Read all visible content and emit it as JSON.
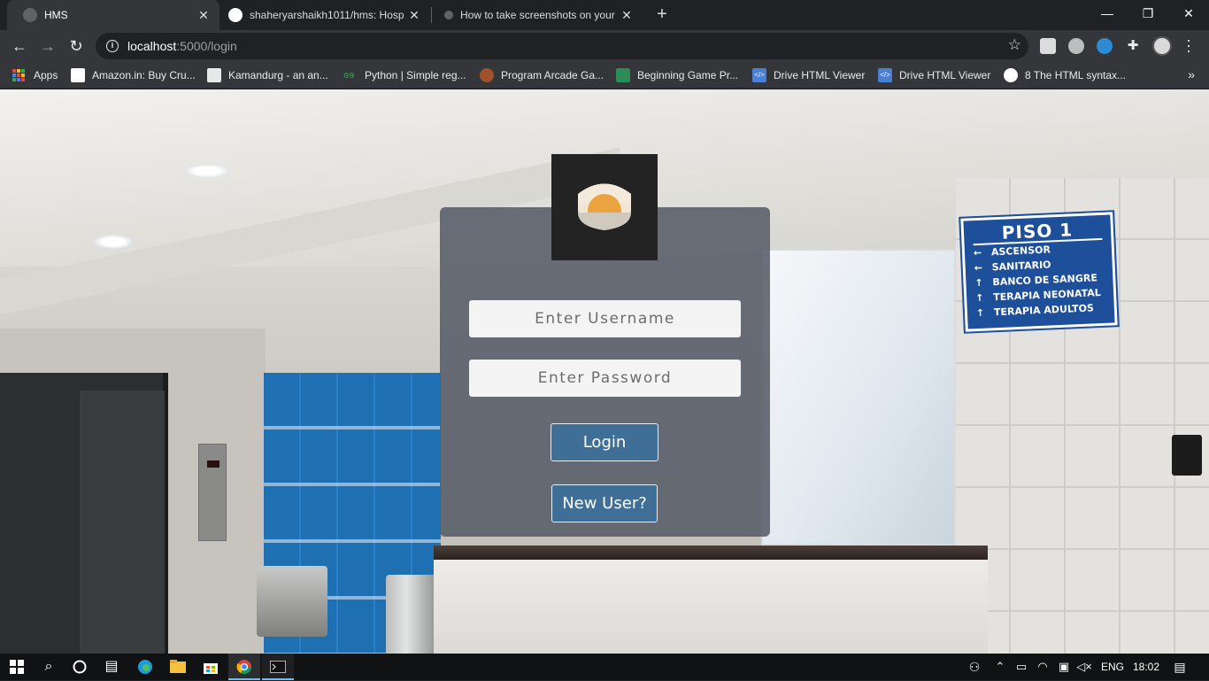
{
  "browser": {
    "tabs": [
      {
        "title": "HMS",
        "active": true
      },
      {
        "title": "shaheryarshaikh1011/hms: Hosp",
        "active": false
      },
      {
        "title": "How to take screenshots on your",
        "active": false
      }
    ],
    "url_host": "localhost",
    "url_path": ":5000/login",
    "bookmarks": [
      "Apps",
      "Amazon.in: Buy Cru...",
      "Kamandurg - an an...",
      "Python | Simple reg...",
      "Program Arcade Ga...",
      "Beginning Game Pr...",
      "Drive HTML Viewer",
      "Drive HTML Viewer",
      "8 The HTML syntax..."
    ],
    "more": "»",
    "window_controls": {
      "minimize": "—",
      "restore": "❐",
      "close": "✕"
    },
    "new_tab": "+"
  },
  "sign": {
    "title": "PISO 1",
    "rows": [
      {
        "arrow": "←",
        "label": "ASCENSOR"
      },
      {
        "arrow": "←",
        "label": "SANITARIO"
      },
      {
        "arrow": "↑",
        "label": "BANCO DE SANGRE"
      },
      {
        "arrow": "↑",
        "label": "TERAPIA NEONATAL"
      },
      {
        "arrow": "↑",
        "label": "TERAPIA ADULTOS"
      }
    ]
  },
  "login": {
    "username_placeholder": "Enter Username",
    "password_placeholder": "Enter Password",
    "login_label": "Login",
    "new_user_label": "New User?"
  },
  "taskbar": {
    "language": "ENG",
    "time": "18:02"
  },
  "colors": {
    "chrome_dark": "#202124",
    "chrome_toolbar": "#35363a",
    "card_bg": "#565c68",
    "button_blue": "#3f6f96",
    "logo_orange": "#eba33f",
    "sign_blue": "#1d4f9a"
  }
}
